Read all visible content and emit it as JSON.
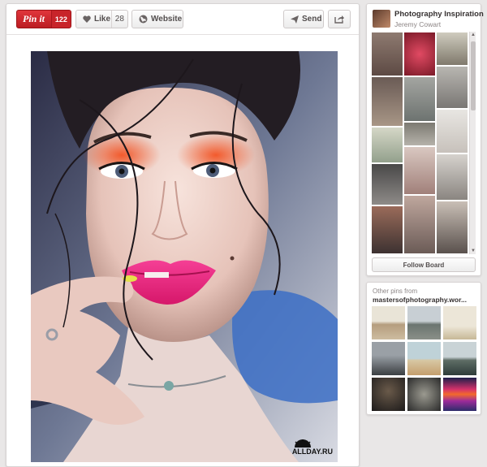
{
  "toolbar": {
    "pinit_label": "Pin it",
    "pinit_count": "122",
    "like_label": "Like",
    "like_count": "28",
    "website_label": "Website",
    "send_label": "Send",
    "share_icon": "share-icon"
  },
  "photo": {
    "watermark_text": "ALLDAY.RU"
  },
  "board": {
    "title": "Photography Inspiration",
    "user": "Jeremy Cowart",
    "follow_label": "Follow Board"
  },
  "other_pins": {
    "label": "Other pins from",
    "source": "mastersofphotography.wor..."
  },
  "colors": {
    "pinit_red": "#cb2027",
    "lip_pink": "#f0257a",
    "eyeshadow_orange": "#e35a33"
  }
}
